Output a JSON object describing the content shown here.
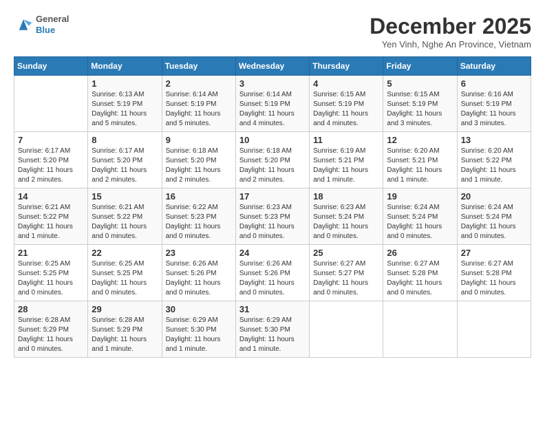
{
  "header": {
    "logo_general": "General",
    "logo_blue": "Blue",
    "month_title": "December 2025",
    "subtitle": "Yen Vinh, Nghe An Province, Vietnam"
  },
  "weekdays": [
    "Sunday",
    "Monday",
    "Tuesday",
    "Wednesday",
    "Thursday",
    "Friday",
    "Saturday"
  ],
  "weeks": [
    [
      {
        "day": "",
        "info": ""
      },
      {
        "day": "1",
        "info": "Sunrise: 6:13 AM\nSunset: 5:19 PM\nDaylight: 11 hours\nand 5 minutes."
      },
      {
        "day": "2",
        "info": "Sunrise: 6:14 AM\nSunset: 5:19 PM\nDaylight: 11 hours\nand 5 minutes."
      },
      {
        "day": "3",
        "info": "Sunrise: 6:14 AM\nSunset: 5:19 PM\nDaylight: 11 hours\nand 4 minutes."
      },
      {
        "day": "4",
        "info": "Sunrise: 6:15 AM\nSunset: 5:19 PM\nDaylight: 11 hours\nand 4 minutes."
      },
      {
        "day": "5",
        "info": "Sunrise: 6:15 AM\nSunset: 5:19 PM\nDaylight: 11 hours\nand 3 minutes."
      },
      {
        "day": "6",
        "info": "Sunrise: 6:16 AM\nSunset: 5:19 PM\nDaylight: 11 hours\nand 3 minutes."
      }
    ],
    [
      {
        "day": "7",
        "info": "Sunrise: 6:17 AM\nSunset: 5:20 PM\nDaylight: 11 hours\nand 2 minutes."
      },
      {
        "day": "8",
        "info": "Sunrise: 6:17 AM\nSunset: 5:20 PM\nDaylight: 11 hours\nand 2 minutes."
      },
      {
        "day": "9",
        "info": "Sunrise: 6:18 AM\nSunset: 5:20 PM\nDaylight: 11 hours\nand 2 minutes."
      },
      {
        "day": "10",
        "info": "Sunrise: 6:18 AM\nSunset: 5:20 PM\nDaylight: 11 hours\nand 2 minutes."
      },
      {
        "day": "11",
        "info": "Sunrise: 6:19 AM\nSunset: 5:21 PM\nDaylight: 11 hours\nand 1 minute."
      },
      {
        "day": "12",
        "info": "Sunrise: 6:20 AM\nSunset: 5:21 PM\nDaylight: 11 hours\nand 1 minute."
      },
      {
        "day": "13",
        "info": "Sunrise: 6:20 AM\nSunset: 5:22 PM\nDaylight: 11 hours\nand 1 minute."
      }
    ],
    [
      {
        "day": "14",
        "info": "Sunrise: 6:21 AM\nSunset: 5:22 PM\nDaylight: 11 hours\nand 1 minute."
      },
      {
        "day": "15",
        "info": "Sunrise: 6:21 AM\nSunset: 5:22 PM\nDaylight: 11 hours\nand 0 minutes."
      },
      {
        "day": "16",
        "info": "Sunrise: 6:22 AM\nSunset: 5:23 PM\nDaylight: 11 hours\nand 0 minutes."
      },
      {
        "day": "17",
        "info": "Sunrise: 6:23 AM\nSunset: 5:23 PM\nDaylight: 11 hours\nand 0 minutes."
      },
      {
        "day": "18",
        "info": "Sunrise: 6:23 AM\nSunset: 5:24 PM\nDaylight: 11 hours\nand 0 minutes."
      },
      {
        "day": "19",
        "info": "Sunrise: 6:24 AM\nSunset: 5:24 PM\nDaylight: 11 hours\nand 0 minutes."
      },
      {
        "day": "20",
        "info": "Sunrise: 6:24 AM\nSunset: 5:24 PM\nDaylight: 11 hours\nand 0 minutes."
      }
    ],
    [
      {
        "day": "21",
        "info": "Sunrise: 6:25 AM\nSunset: 5:25 PM\nDaylight: 11 hours\nand 0 minutes."
      },
      {
        "day": "22",
        "info": "Sunrise: 6:25 AM\nSunset: 5:25 PM\nDaylight: 11 hours\nand 0 minutes."
      },
      {
        "day": "23",
        "info": "Sunrise: 6:26 AM\nSunset: 5:26 PM\nDaylight: 11 hours\nand 0 minutes."
      },
      {
        "day": "24",
        "info": "Sunrise: 6:26 AM\nSunset: 5:26 PM\nDaylight: 11 hours\nand 0 minutes."
      },
      {
        "day": "25",
        "info": "Sunrise: 6:27 AM\nSunset: 5:27 PM\nDaylight: 11 hours\nand 0 minutes."
      },
      {
        "day": "26",
        "info": "Sunrise: 6:27 AM\nSunset: 5:28 PM\nDaylight: 11 hours\nand 0 minutes."
      },
      {
        "day": "27",
        "info": "Sunrise: 6:27 AM\nSunset: 5:28 PM\nDaylight: 11 hours\nand 0 minutes."
      }
    ],
    [
      {
        "day": "28",
        "info": "Sunrise: 6:28 AM\nSunset: 5:29 PM\nDaylight: 11 hours\nand 0 minutes."
      },
      {
        "day": "29",
        "info": "Sunrise: 6:28 AM\nSunset: 5:29 PM\nDaylight: 11 hours\nand 1 minute."
      },
      {
        "day": "30",
        "info": "Sunrise: 6:29 AM\nSunset: 5:30 PM\nDaylight: 11 hours\nand 1 minute."
      },
      {
        "day": "31",
        "info": "Sunrise: 6:29 AM\nSunset: 5:30 PM\nDaylight: 11 hours\nand 1 minute."
      },
      {
        "day": "",
        "info": ""
      },
      {
        "day": "",
        "info": ""
      },
      {
        "day": "",
        "info": ""
      }
    ]
  ]
}
